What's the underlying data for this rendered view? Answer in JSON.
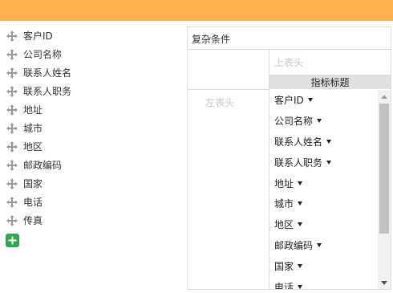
{
  "colors": {
    "topbar": "#FFB34D",
    "add_button": "#2ea84f",
    "metric_header_bg": "#e0e0e0",
    "drag_icon": "#8e9aa4"
  },
  "fields": [
    {
      "label": "客户ID",
      "icon": "drag-move-icon"
    },
    {
      "label": "公司名称",
      "icon": "drag-move-icon"
    },
    {
      "label": "联系人姓名",
      "icon": "drag-move-icon"
    },
    {
      "label": "联系人职务",
      "icon": "drag-move-icon"
    },
    {
      "label": "地址",
      "icon": "drag-move-icon"
    },
    {
      "label": "城市",
      "icon": "drag-move-icon"
    },
    {
      "label": "地区",
      "icon": "drag-move-icon"
    },
    {
      "label": "邮政编码",
      "icon": "drag-move-icon"
    },
    {
      "label": "国家",
      "icon": "drag-move-icon"
    },
    {
      "label": "电话",
      "icon": "drag-move-icon"
    },
    {
      "label": "传真",
      "icon": "drag-move-icon"
    }
  ],
  "add_button": {
    "icon": "plus-icon"
  },
  "panel": {
    "title": "复杂条件",
    "top_header_placeholder": "上表头",
    "metric_header": "指标标题",
    "left_header_placeholder": "左表头",
    "dimensions": [
      {
        "label": "客户ID"
      },
      {
        "label": "公司名称"
      },
      {
        "label": "联系人姓名"
      },
      {
        "label": "联系人职务"
      },
      {
        "label": "地址"
      },
      {
        "label": "城市"
      },
      {
        "label": "地区"
      },
      {
        "label": "邮政编码"
      },
      {
        "label": "国家"
      },
      {
        "label": "电话"
      }
    ]
  }
}
